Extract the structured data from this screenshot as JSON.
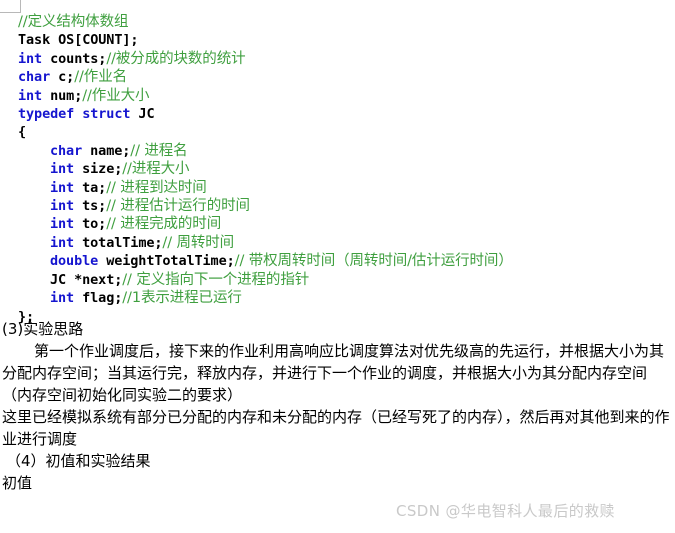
{
  "code_block": {
    "language": "c",
    "colors": {
      "keyword": "#1515cf",
      "comment": "#3f9f3f",
      "identifier": "#000000",
      "background": "#ffffff"
    },
    "lines": [
      {
        "comment_cjk": "//定义结构体数组"
      },
      {
        "identifier": "Task OS[COUNT];"
      },
      {
        "keyword": "int",
        "identifier": " counts;",
        "comment_cjk": "//被分成的块数的统计"
      },
      {
        "keyword": "char",
        "identifier": " c;",
        "comment_cjk": "//作业名"
      },
      {
        "keyword": "int",
        "identifier": " num;",
        "comment_cjk": "//作业大小"
      },
      {
        "keyword": "typedef struct",
        "identifier": " JC"
      },
      {
        "identifier": "{"
      },
      {
        "indent": true,
        "keyword": "char",
        "identifier": " name;",
        "comment_cjk": "// 进程名"
      },
      {
        "indent": true,
        "keyword": "int",
        "identifier": " size;",
        "comment_cjk": "//进程大小"
      },
      {
        "indent": true,
        "keyword": "int",
        "identifier": " ta;",
        "comment_cjk": "// 进程到达时间"
      },
      {
        "indent": true,
        "keyword": "int",
        "identifier": " ts;",
        "comment_cjk": "// 进程估计运行的时间"
      },
      {
        "indent": true,
        "keyword": "int",
        "identifier": " to;",
        "comment_cjk": "// 进程完成的时间"
      },
      {
        "indent": true,
        "keyword": "int",
        "identifier": " totalTime;",
        "comment_cjk": "// 周转时间"
      },
      {
        "indent": true,
        "keyword": "double",
        "identifier": " weightTotalTime;",
        "comment_cjk": "// 带权周转时间（周转时间/估计运行时间）"
      },
      {
        "indent": true,
        "identifier": "JC *next;",
        "comment_cjk": "// 定义指向下一个进程的指针"
      },
      {
        "indent": true,
        "keyword": "int",
        "identifier": " flag;",
        "comment_cjk": "//1表示进程已运行"
      },
      {
        "identifier": "};"
      }
    ]
  },
  "body": {
    "heading_3": "(3)实验思路",
    "paragraph_1": "第一个作业调度后，接下来的作业利用高响应比调度算法对优先级高的先运行，并根据大小为其分配内存空间；当其运行完，释放内存，并进行下一个作业的调度，并根据大小为其分配内存空间（内存空间初始化同实验二的要求）",
    "paragraph_2": "这里已经模拟系统有部分已分配的内存和未分配的内存（已经写死了的内存），然后再对其他到来的作业进行调度",
    "heading_4": "（4）初值和实验结果",
    "label_initial_value": "初值"
  },
  "watermark": {
    "text": "CSDN @华电智科人最后的救赎",
    "color": "#c9c9c9"
  }
}
